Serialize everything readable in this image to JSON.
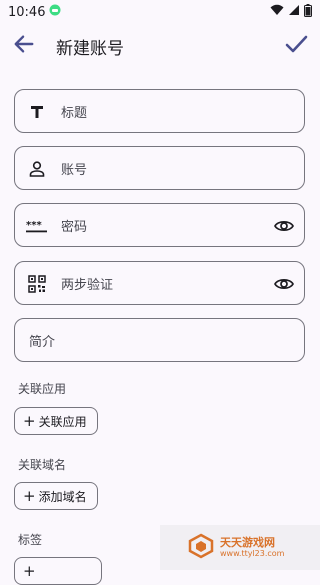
{
  "status_bar": {
    "time": "10:46"
  },
  "app_bar": {
    "title": "新建账号"
  },
  "fields": {
    "title_placeholder": "标题",
    "account_placeholder": "账号",
    "password_placeholder": "密码",
    "two_step_placeholder": "两步验证",
    "intro_placeholder": "简介"
  },
  "sections": {
    "linked_apps": {
      "label": "关联应用",
      "chip": "关联应用"
    },
    "linked_domains": {
      "label": "关联域名",
      "chip": "添加域名"
    },
    "tags": {
      "label": "标签"
    }
  },
  "watermark": {
    "text": "天天游戏网",
    "url": "www.ttyl23.com"
  },
  "colors": {
    "accent": "#4a4f8f",
    "outline": "#76757e",
    "background": "#fbf8fd"
  }
}
